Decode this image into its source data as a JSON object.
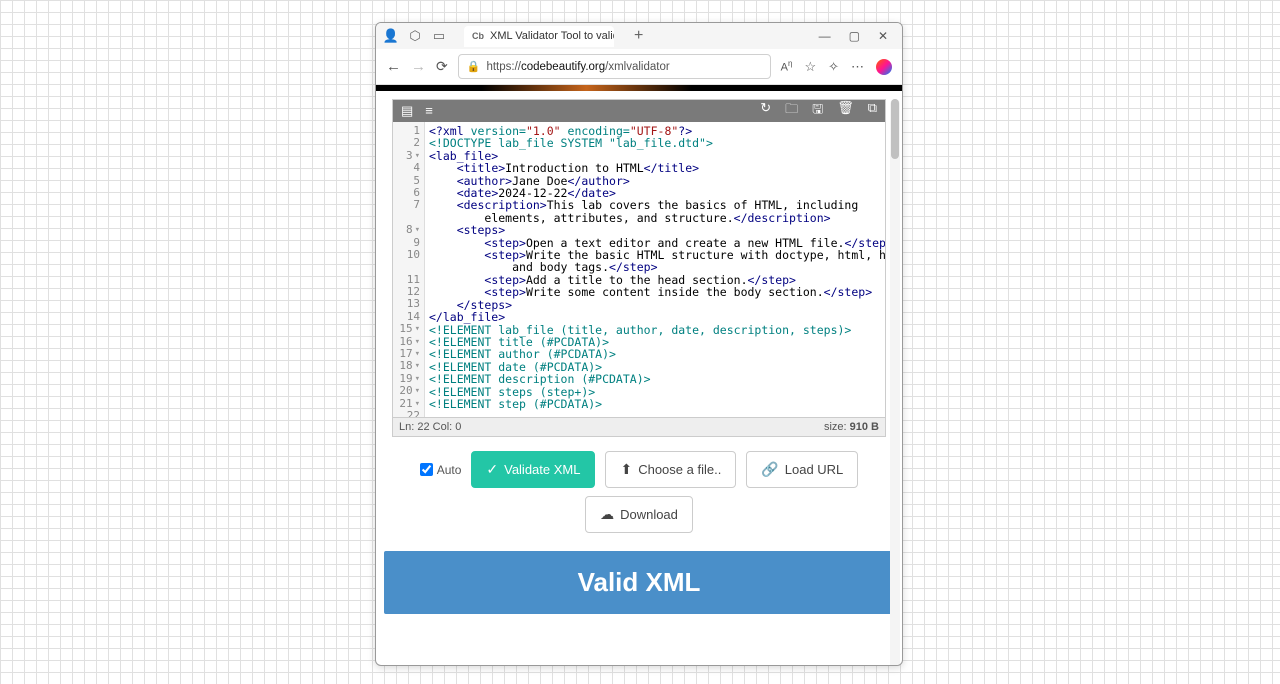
{
  "tab": {
    "favicon": "Cb",
    "title": "XML Validator Tool to validate XM"
  },
  "url": {
    "proto": "https://",
    "host": "codebeautify.org",
    "path": "/xmlvalidator"
  },
  "editor": {
    "lines": [
      {
        "n": 1,
        "type": "pi",
        "indent": 0,
        "raw": "<?xml version=\"1.0\" encoding=\"UTF-8\"?>"
      },
      {
        "n": 2,
        "type": "doctype",
        "indent": 0,
        "raw": "<!DOCTYPE lab_file SYSTEM \"lab_file.dtd\">"
      },
      {
        "n": 3,
        "fold": true,
        "indent": 0,
        "open": "lab_file"
      },
      {
        "n": 4,
        "indent": 2,
        "open": "title",
        "text": "Introduction to HTML",
        "close": "title"
      },
      {
        "n": 5,
        "indent": 2,
        "open": "author",
        "text": "Jane Doe",
        "close": "author"
      },
      {
        "n": 6,
        "indent": 2,
        "open": "date",
        "text": "2024-12-22",
        "close": "date"
      },
      {
        "n": 7,
        "indent": 2,
        "open": "description",
        "text": "This lab covers the basics of HTML, including"
      },
      {
        "n": -1,
        "indent": 4,
        "text": "elements, attributes, and structure.",
        "close": "description"
      },
      {
        "n": 8,
        "fold": true,
        "indent": 2,
        "open": "steps"
      },
      {
        "n": 9,
        "indent": 4,
        "open": "step",
        "text": "Open a text editor and create a new HTML file.",
        "close": "step"
      },
      {
        "n": 10,
        "indent": 4,
        "open": "step",
        "text": "Write the basic HTML structure with doctype, html, head,"
      },
      {
        "n": -1,
        "indent": 6,
        "text": "and body tags.",
        "close": "step"
      },
      {
        "n": 11,
        "indent": 4,
        "open": "step",
        "text": "Add a title to the head section.",
        "close": "step"
      },
      {
        "n": 12,
        "indent": 4,
        "open": "step",
        "text": "Write some content inside the body section.",
        "close": "step"
      },
      {
        "n": 13,
        "indent": 2,
        "close": "steps"
      },
      {
        "n": 14,
        "indent": 0,
        "close": "lab_file"
      },
      {
        "n": 15,
        "fold": true,
        "indent": 0,
        "type": "doctype",
        "raw": "<!ELEMENT lab_file (title, author, date, description, steps)>"
      },
      {
        "n": 16,
        "fold": true,
        "indent": 0,
        "type": "doctype",
        "raw": "<!ELEMENT title (#PCDATA)>"
      },
      {
        "n": 17,
        "fold": true,
        "indent": 0,
        "type": "doctype",
        "raw": "<!ELEMENT author (#PCDATA)>"
      },
      {
        "n": 18,
        "fold": true,
        "indent": 0,
        "type": "doctype",
        "raw": "<!ELEMENT date (#PCDATA)>"
      },
      {
        "n": 19,
        "fold": true,
        "indent": 0,
        "type": "doctype",
        "raw": "<!ELEMENT description (#PCDATA)>"
      },
      {
        "n": 20,
        "fold": true,
        "indent": 0,
        "type": "doctype",
        "raw": "<!ELEMENT steps (step+)>"
      },
      {
        "n": 21,
        "fold": true,
        "indent": 0,
        "type": "doctype",
        "raw": "<!ELEMENT step (#PCDATA)>"
      },
      {
        "n": 22,
        "indent": 0
      }
    ],
    "status": {
      "left": "Ln: 22 Col: 0",
      "right_label": "size: ",
      "right_value": "910 B"
    }
  },
  "buttons": {
    "auto": "Auto",
    "validate": "Validate XML",
    "choose": "Choose a file..",
    "load": "Load URL",
    "download": "Download"
  },
  "result": "Valid XML"
}
